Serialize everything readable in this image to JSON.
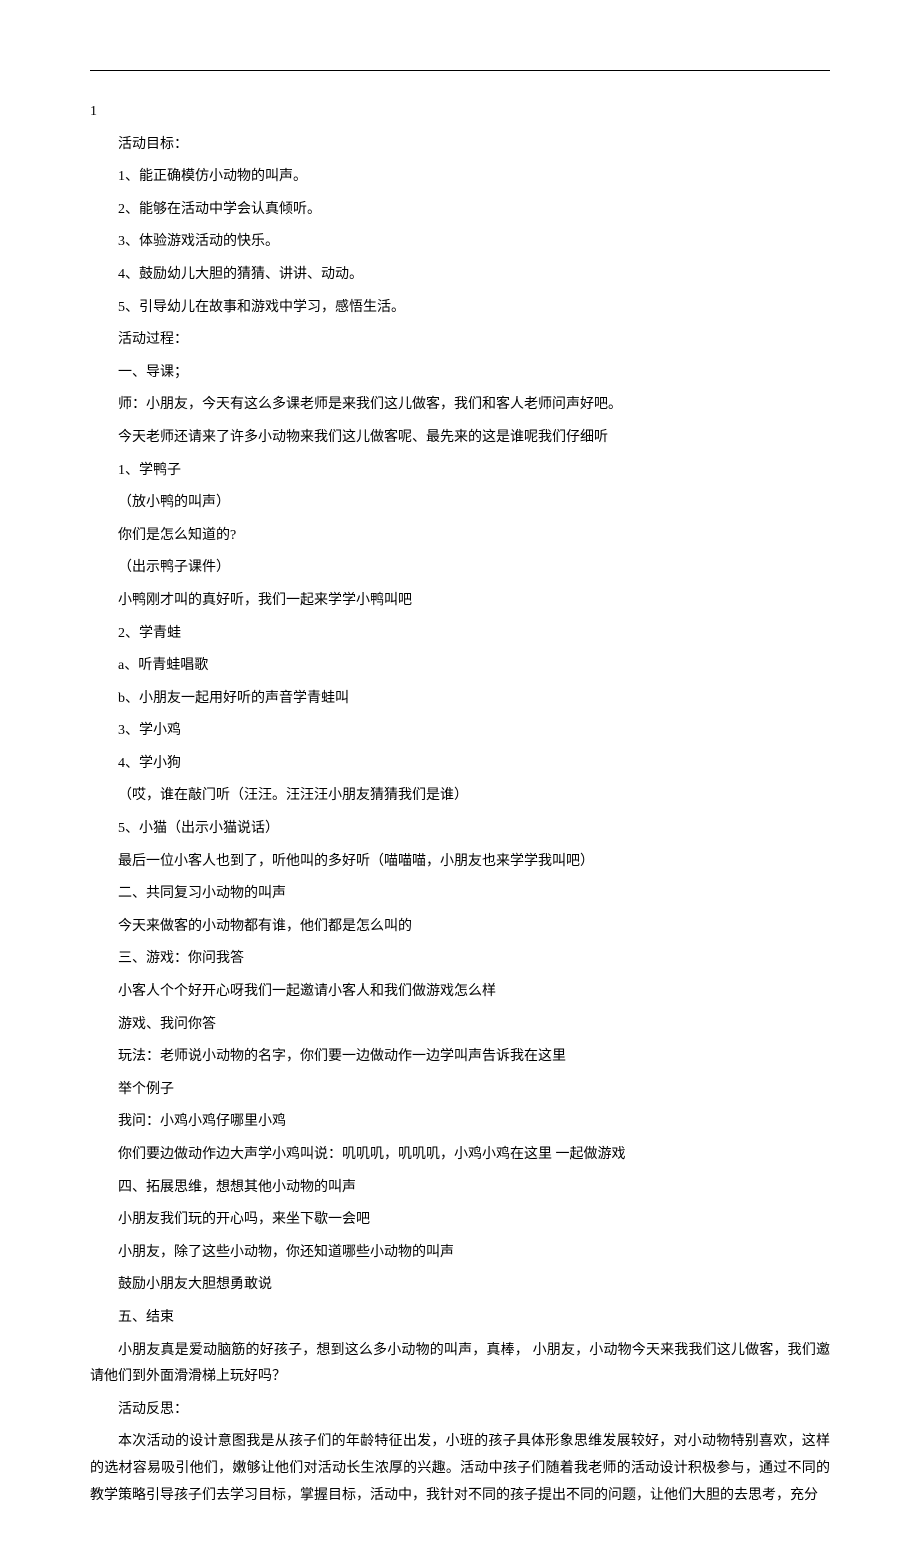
{
  "hr": "",
  "numLeft": "1",
  "lines": [
    "活动目标：",
    "1、能正确模仿小动物的叫声。",
    "2、能够在活动中学会认真倾听。",
    "3、体验游戏活动的快乐。",
    "4、鼓励幼儿大胆的猜猜、讲讲、动动。",
    "5、引导幼儿在故事和游戏中学习，感悟生活。",
    "活动过程：",
    "一、导课；",
    "师：小朋友，今天有这么多课老师是来我们这儿做客，我们和客人老师问声好吧。",
    "今天老师还请来了许多小动物来我们这儿做客呢、最先来的这是谁呢我们仔细听",
    "1、学鸭子",
    "（放小鸭的叫声）",
    "你们是怎么知道的?",
    "（出示鸭子课件）",
    "小鸭刚才叫的真好听，我们一起来学学小鸭叫吧",
    "2、学青蛙",
    "a、听青蛙唱歌",
    "b、小朋友一起用好听的声音学青蛙叫",
    "3、学小鸡",
    "4、学小狗",
    "（哎，谁在敲门听（汪汪。汪汪汪小朋友猜猜我们是谁）",
    "5、小猫（出示小猫说话）",
    "最后一位小客人也到了，听他叫的多好听（喵喵喵，小朋友也来学学我叫吧）",
    "二、共同复习小动物的叫声",
    "今天来做客的小动物都有谁，他们都是怎么叫的",
    "三、游戏：你问我答",
    "小客人个个好开心呀我们一起邀请小客人和我们做游戏怎么样",
    "游戏、我问你答",
    "玩法：老师说小动物的名字，你们要一边做动作一边学叫声告诉我在这里",
    "举个例子",
    "我问：小鸡小鸡仔哪里小鸡",
    "你们要边做动作边大声学小鸡叫说：叽叽叽，叽叽叽，小鸡小鸡在这里 一起做游戏",
    "四、拓展思维，想想其他小动物的叫声",
    "小朋友我们玩的开心吗，来坐下歇一会吧",
    "小朋友，除了这些小动物，你还知道哪些小动物的叫声",
    "鼓励小朋友大胆想勇敢说",
    "五、结束"
  ],
  "wrap1": "小朋友真是爱动脑筋的好孩子，想到这么多小动物的叫声，真棒， 小朋友，小动物今天来我我们这儿做客，我们邀请他们到外面滑滑梯上玩好吗？",
  "wrap2label": "活动反思：",
  "wrap2": "本次活动的设计意图我是从孩子们的年龄特征出发，小班的孩子具体形象思维发展较好，对小动物特别喜欢，这样的选材容易吸引他们，嫩够让他们对活动长生浓厚的兴趣。活动中孩子们随着我老师的活动设计积极参与，通过不同的教学策略引导孩子们去学习目标，掌握目标，活动中，我针对不同的孩子提出不同的问题，让他们大胆的去思考，充分"
}
